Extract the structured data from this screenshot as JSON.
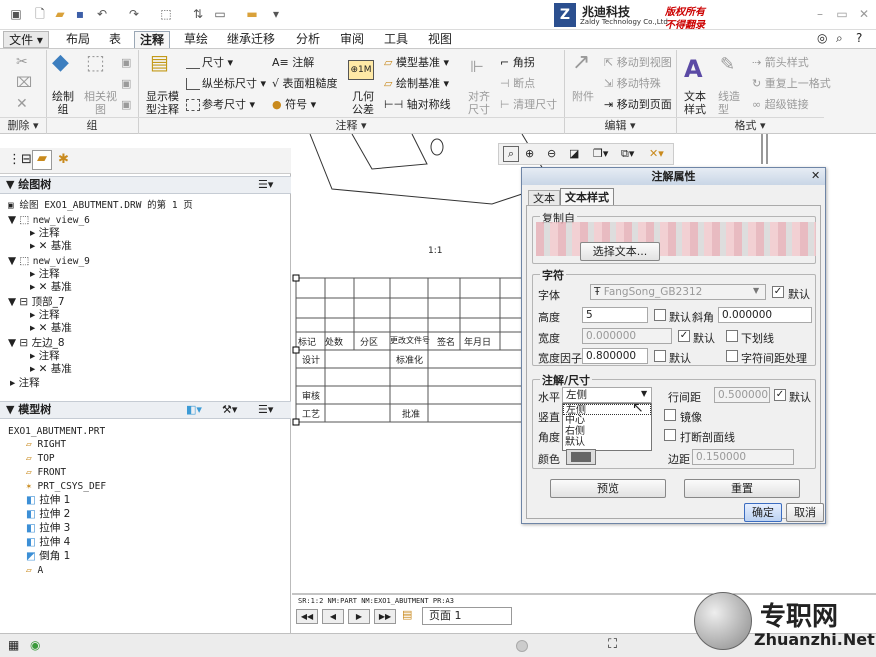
{
  "quick_access": {
    "icons": [
      "new-icon",
      "open-icon",
      "save-icon",
      "undo-icon",
      "redo-icon",
      "select-icon",
      "regenerate-icon",
      "window-icon",
      "folder-icon"
    ]
  },
  "brand": {
    "name": "兆迪科技",
    "sub": "Zaldy Technology Co.,Ltd",
    "slogan1": "版权所有",
    "slogan2": "不得翻录"
  },
  "tabs": [
    "文件",
    "布局",
    "表",
    "注释",
    "草绘",
    "继承迁移",
    "分析",
    "审阅",
    "工具",
    "视图"
  ],
  "ribbon": {
    "delete": {
      "label": "删除"
    },
    "group_group": {
      "label": "组",
      "draw_group": "绘制\n组",
      "related_view": "相关视\n图"
    },
    "annotation": {
      "label": "注释",
      "show_model": "显示模\n型注释",
      "dim": "尺寸",
      "ordinate": "纵坐标尺寸",
      "ref_dim": "参考尺寸",
      "note": "注解",
      "surface_finish": "表面粗糙度",
      "symbol": "符号",
      "gtol": "几何\n公差",
      "model_datum": "模型基准",
      "draw_datum": "绘制基准",
      "axis_sym": "轴对称线",
      "align_dim": "对齐\n尺寸",
      "corner": "角拐",
      "breakpoint": "断点",
      "clean_dim": "清理尺寸"
    },
    "edit": {
      "label": "编辑",
      "attach": "附件",
      "move_view": "移动到视图",
      "move_special": "移动特殊",
      "move_page": "移动到页面"
    },
    "format": {
      "label": "格式",
      "text_style": "文本\n样式",
      "line_style": "线造\n型",
      "arrow_style": "箭头样式",
      "repeat_format": "重复上一格式",
      "hyperlink": "超级链接"
    }
  },
  "drawing_tree": {
    "title": "绘图树",
    "root": "绘图 EXO1_ABUTMENT.DRW 的第 1 页",
    "views": [
      {
        "name": "new_view_6",
        "children": [
          "注释",
          "基准"
        ]
      },
      {
        "name": "new_view_9",
        "children": [
          "注释",
          "基准"
        ]
      },
      {
        "name": "顶部_7",
        "children": [
          "注释",
          "基准"
        ]
      },
      {
        "name": "左边_8",
        "children": [
          "注释",
          "基准"
        ]
      }
    ],
    "last": "注释"
  },
  "model_tree": {
    "title": "模型树",
    "root": "EXO1_ABUTMENT.PRT",
    "items": [
      "RIGHT",
      "TOP",
      "FRONT",
      "PRT_CSYS_DEF",
      "拉伸 1",
      "拉伸 2",
      "拉伸 3",
      "拉伸 4",
      "倒角 1",
      "A"
    ]
  },
  "drawing": {
    "scale_label": "1:1",
    "title_block": {
      "r1": [
        "标记",
        "处数",
        "分区",
        "更改文件号",
        "签名",
        "年月日"
      ],
      "design": "设计",
      "std": "标准化",
      "check": "审核",
      "process": "工艺",
      "approve": "批准"
    },
    "bottom_info": "SR:1:2    NM:PART   NM:EXO1_ABUTMENT   PR:A3",
    "page_label": "页面 1"
  },
  "dialog": {
    "title": "注解属性",
    "tab_text": "文本",
    "tab_style": "文本样式",
    "copy_from": "复制自",
    "select_text_btn": "选择文本...",
    "char_section": "字符",
    "font_label": "字体",
    "font_value": "FangSong_GB2312",
    "default": "默认",
    "height_label": "高度",
    "height_value": "5",
    "slant_label": "斜角",
    "slant_value": "0.000000",
    "thickness_label": "宽度",
    "thickness_value": "0.000000",
    "underline": "下划线",
    "width_factor_label": "宽度因子",
    "width_factor_value": "0.800000",
    "kerning": "字符间距处理",
    "note_section": "注解/尺寸",
    "horizontal_label": "水平",
    "horizontal_value": "左侧",
    "horizontal_options": [
      "左侧",
      "中心",
      "右侧",
      "默认"
    ],
    "vertical_label": "竖直",
    "angle_label": "角度",
    "color_label": "颜色",
    "line_spacing_label": "行间距",
    "line_spacing_value": "0.500000",
    "mirror": "镜像",
    "break_hatch": "打断剖面线",
    "margin_label": "边距",
    "margin_value": "0.150000",
    "preview": "预览",
    "reset": "重置",
    "ok": "确定",
    "cancel": "取消"
  },
  "watermark": {
    "cn": "专职网",
    "en": "Zhuanzhi.Net"
  }
}
